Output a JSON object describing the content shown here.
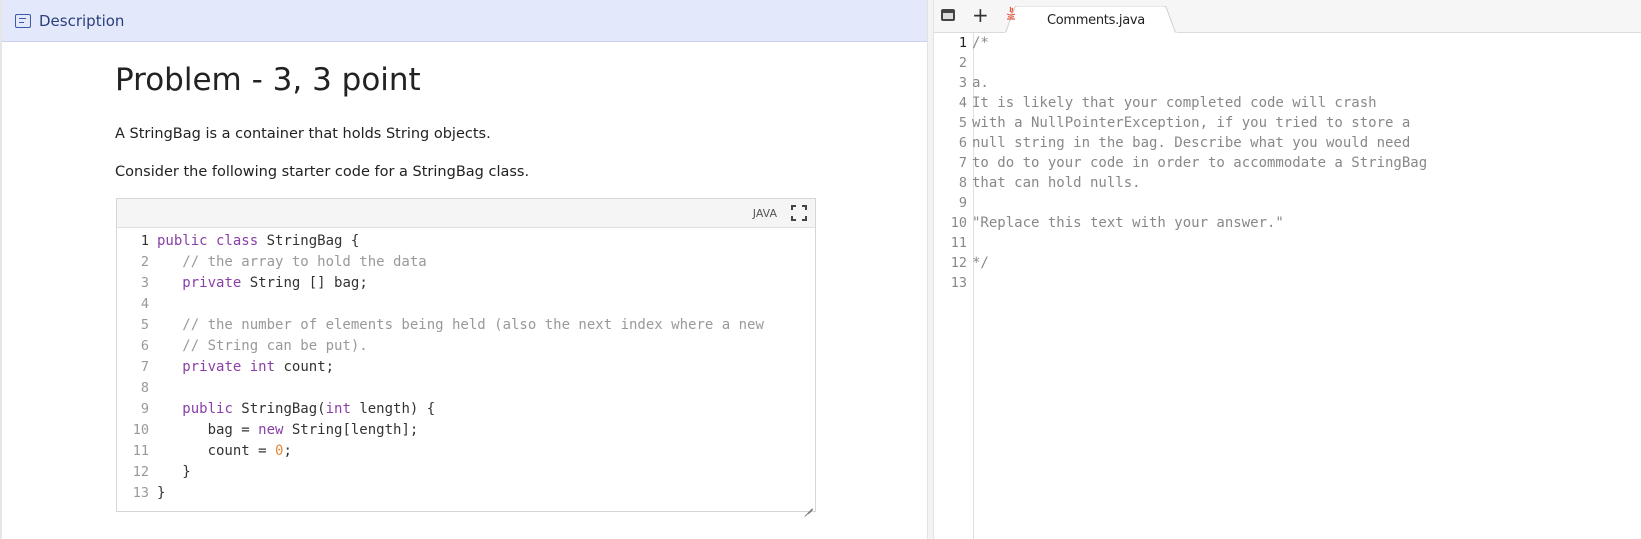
{
  "description_panel": {
    "header_label": "Description",
    "problem_title": "Problem - 3, 3 point",
    "paragraphs": [
      "A StringBag is a container that holds String objects.",
      "Consider the following starter code for a StringBag class."
    ],
    "code_block": {
      "language_label": "JAVA",
      "lines": [
        {
          "num": "1",
          "tokens": [
            {
              "t": "kw",
              "v": "public class"
            },
            {
              "t": "tx",
              "v": " StringBag {"
            }
          ]
        },
        {
          "num": "2",
          "tokens": [
            {
              "t": "cm",
              "v": "   // the array to hold the data"
            }
          ]
        },
        {
          "num": "3",
          "tokens": [
            {
              "t": "tx",
              "v": "   "
            },
            {
              "t": "kw",
              "v": "private"
            },
            {
              "t": "tx",
              "v": " String [] bag;"
            }
          ]
        },
        {
          "num": "4",
          "tokens": []
        },
        {
          "num": "5",
          "tokens": [
            {
              "t": "cm",
              "v": "   // the number of elements being held (also the next index where a new"
            }
          ]
        },
        {
          "num": "6",
          "tokens": [
            {
              "t": "cm",
              "v": "   // String can be put)."
            }
          ]
        },
        {
          "num": "7",
          "tokens": [
            {
              "t": "tx",
              "v": "   "
            },
            {
              "t": "kw",
              "v": "private"
            },
            {
              "t": "tx",
              "v": " "
            },
            {
              "t": "kw",
              "v": "int"
            },
            {
              "t": "tx",
              "v": " count;"
            }
          ]
        },
        {
          "num": "8",
          "tokens": []
        },
        {
          "num": "9",
          "tokens": [
            {
              "t": "tx",
              "v": "   "
            },
            {
              "t": "kw",
              "v": "public"
            },
            {
              "t": "tx",
              "v": " StringBag("
            },
            {
              "t": "kw",
              "v": "int"
            },
            {
              "t": "tx",
              "v": " length) {"
            }
          ]
        },
        {
          "num": "10",
          "tokens": [
            {
              "t": "tx",
              "v": "      bag = "
            },
            {
              "t": "kw",
              "v": "new"
            },
            {
              "t": "tx",
              "v": " String[length];"
            }
          ]
        },
        {
          "num": "11",
          "tokens": [
            {
              "t": "tx",
              "v": "      count = "
            },
            {
              "t": "num",
              "v": "0"
            },
            {
              "t": "tx",
              "v": ";"
            }
          ]
        },
        {
          "num": "12",
          "tokens": [
            {
              "t": "tx",
              "v": "   }"
            }
          ]
        },
        {
          "num": "13",
          "tokens": [
            {
              "t": "tx",
              "v": "}"
            }
          ]
        }
      ]
    }
  },
  "editor_panel": {
    "add_tab_label": "+",
    "active_tab": "Comments.java",
    "lines": [
      {
        "num": "1",
        "text": "/*"
      },
      {
        "num": "2",
        "text": ""
      },
      {
        "num": "3",
        "text": "a."
      },
      {
        "num": "4",
        "text": "It is likely that your completed code will crash"
      },
      {
        "num": "5",
        "text": "with a NullPointerException, if you tried to store a"
      },
      {
        "num": "6",
        "text": "null string in the bag. Describe what you would need"
      },
      {
        "num": "7",
        "text": "to do to your code in order to accommodate a StringBag"
      },
      {
        "num": "8",
        "text": "that can hold nulls."
      },
      {
        "num": "9",
        "text": ""
      },
      {
        "num": "10",
        "text": "\"Replace this text with your answer.\""
      },
      {
        "num": "11",
        "text": ""
      },
      {
        "num": "12",
        "text": "*/"
      },
      {
        "num": "13",
        "text": ""
      }
    ]
  },
  "colors": {
    "header_bg": "#e3e8fa",
    "keyword": "#8a3fa8",
    "comment": "#999999",
    "number": "#e5883a"
  }
}
